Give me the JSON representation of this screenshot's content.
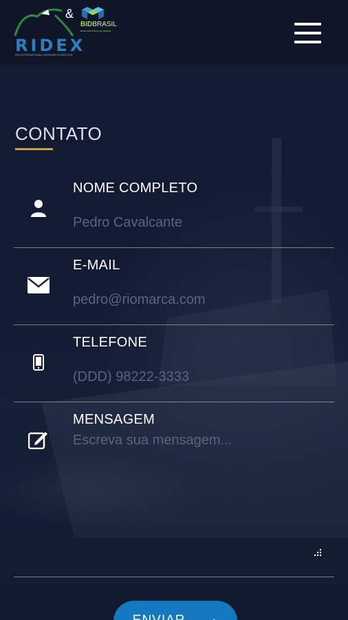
{
  "header": {
    "ridex_logo_text": "RIDEX",
    "ridex_logo_subtitle": "RIO INTERNATIONAL DEFENSE EXHIBITION",
    "ampersand": "&",
    "bid_logo_text": "BID",
    "bid_logo_text2": "BRASIL",
    "bid_logo_subtitle": "BASE INDUSTRIAL DE DEFESA",
    "menu_icon": "hamburger-menu-icon"
  },
  "contact": {
    "title": "CONTATO",
    "accent_color": "#c9a24a",
    "fields": [
      {
        "label": "NOME COMPLETO",
        "placeholder": "Pedro Cavalcante",
        "icon": "user-icon",
        "value": ""
      },
      {
        "label": "E-MAIL",
        "placeholder": "pedro@riomarca.com",
        "icon": "envelope-icon",
        "value": ""
      },
      {
        "label": "TELEFONE",
        "placeholder": "(DDD) 98222-3333",
        "icon": "phone-icon",
        "value": ""
      },
      {
        "label": "MENSAGEM",
        "placeholder": "Escreva sua mensagem...",
        "icon": "edit-icon",
        "value": ""
      }
    ],
    "submit_label": "ENVIAR",
    "submit_color": "#1579bf"
  }
}
